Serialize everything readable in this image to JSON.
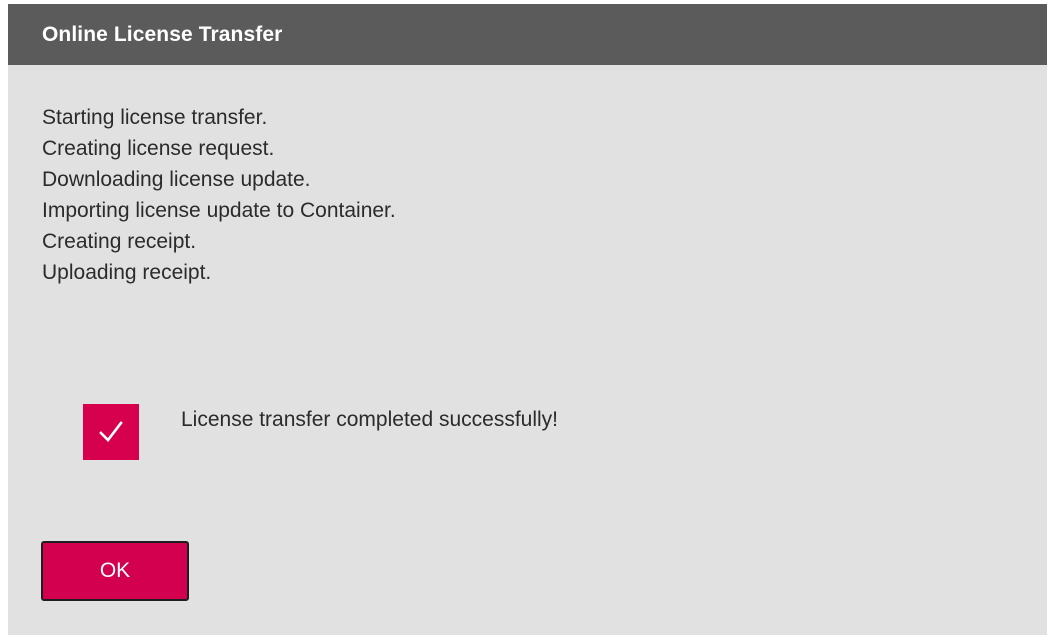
{
  "dialog": {
    "title": "Online License Transfer",
    "log_lines": [
      "Starting license transfer.",
      "Creating license request.",
      "Downloading license update.",
      "Importing license update to Container.",
      "Creating receipt.",
      "Uploading receipt."
    ],
    "status": {
      "icon": "checkmark-icon",
      "message": "License transfer completed successfully!",
      "color": "#d6004f"
    },
    "ok_label": "OK"
  },
  "colors": {
    "title_bar": "#5b5b5b",
    "background": "#e1e1e1",
    "accent": "#d3004f"
  }
}
